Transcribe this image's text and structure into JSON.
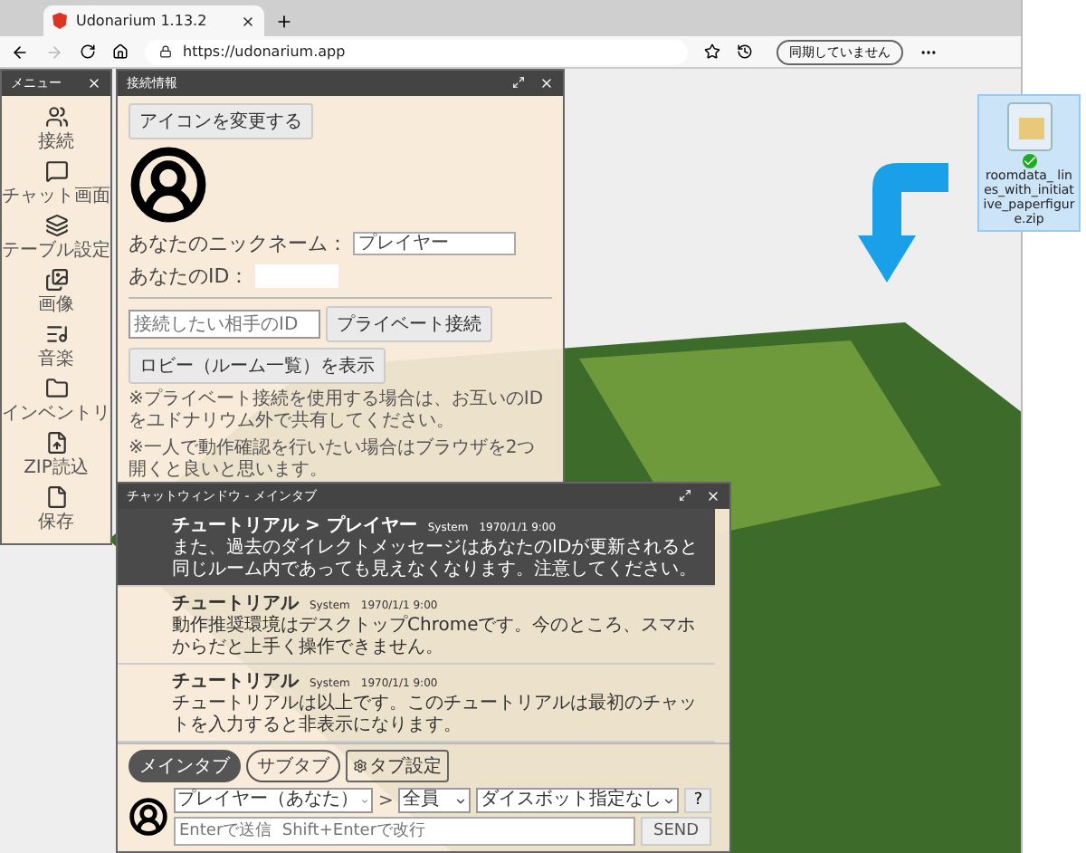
{
  "browser": {
    "tab_title": "Udonarium 1.13.2",
    "url": "https://udonarium.app",
    "profile_button": "同期していません"
  },
  "menu": {
    "title": "メニュー",
    "items": [
      {
        "label": "接続"
      },
      {
        "label": "チャット画面"
      },
      {
        "label": "テーブル設定"
      },
      {
        "label": "画像"
      },
      {
        "label": "音楽"
      },
      {
        "label": "インベントリ"
      },
      {
        "label": "ZIP読込"
      },
      {
        "label": "保存"
      }
    ]
  },
  "connection_panel": {
    "title": "接続情報",
    "change_icon_button": "アイコンを変更する",
    "nickname_label": "あなたのニックネーム：",
    "nickname_value": "プレイヤー",
    "id_label": "あなたのID：",
    "peer_id_placeholder": "接続したい相手のID",
    "private_connect_button": "プライベート接続",
    "lobby_button": "ロビー（ルーム一覧）を表示",
    "notes": [
      "※プライベート接続を使用する場合は、お互いのIDをユドナリウム外で共有してください。",
      "※一人で動作確認を行いたい場合はブラウザを2つ開くと良いと思います。"
    ]
  },
  "chat_window": {
    "title": "チャットウィンドウ - メインタブ",
    "messages": [
      {
        "kind": "direct",
        "from": "チュートリアル > プレイヤー",
        "sender_type": "System",
        "time": "1970/1/1 9:00",
        "text": "また、過去のダイレクトメッセージはあなたのIDが更新されると同じルーム内であっても見えなくなります。注意してください。"
      },
      {
        "kind": "public",
        "from": "チュートリアル",
        "sender_type": "System",
        "time": "1970/1/1 9:00",
        "text": "動作推奨環境はデスクトップChromeです。今のところ、スマホからだと上手く操作できません。"
      },
      {
        "kind": "public",
        "from": "チュートリアル",
        "sender_type": "System",
        "time": "1970/1/1 9:00",
        "text": "チュートリアルは以上です。このチュートリアルは最初のチャットを入力すると非表示になります。"
      }
    ],
    "tabs": [
      {
        "label": "メインタブ",
        "selected": true
      },
      {
        "label": "サブタブ",
        "selected": false
      }
    ],
    "tab_settings_button": "タブ設定",
    "sender": "プレイヤー（あなた）",
    "arrow": ">",
    "target": "全員",
    "dicebot": "ダイスボット指定なし",
    "help_button": "?",
    "input_placeholder": "Enterで送信  Shift+Enterで改行",
    "send_button": "SEND"
  },
  "desktop_file": {
    "name": "roomdata_ lines_with_initiative_paperfigure.zip"
  }
}
